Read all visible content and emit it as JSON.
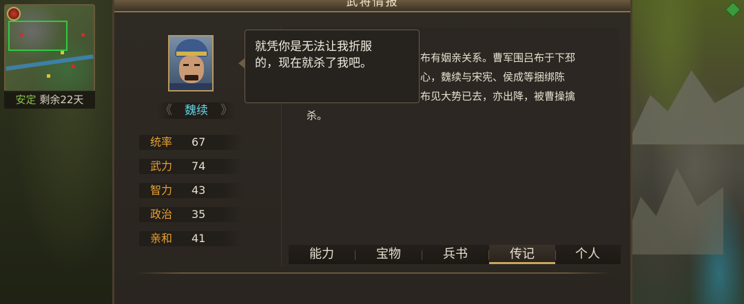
{
  "window": {
    "title": "武将情报"
  },
  "minimap": {
    "status_word": "安定",
    "remaining_label": "剩余22天"
  },
  "general": {
    "name": "魏续",
    "stats": [
      {
        "label": "统率",
        "value": "67"
      },
      {
        "label": "武力",
        "value": "74"
      },
      {
        "label": "智力",
        "value": "43"
      },
      {
        "label": "政治",
        "value": "35"
      },
      {
        "label": "亲和",
        "value": "41"
      }
    ]
  },
  "speech": {
    "text": "就凭你是无法让我折服\n的，现在就杀了我吧。"
  },
  "biography": {
    "lines": [
      "吕布有姻亲关系。曹军围吕布于下邳",
      "离心，魏续与宋宪、侯成等捆绑陈",
      "吕布见大势已去，亦出降，被曹操擒",
      "杀。"
    ]
  },
  "tabs": [
    {
      "label": "能力",
      "active": false
    },
    {
      "label": "宝物",
      "active": false
    },
    {
      "label": "兵书",
      "active": false
    },
    {
      "label": "传记",
      "active": true
    },
    {
      "label": "个人",
      "active": false
    }
  ],
  "colors": {
    "accent_gold": "#c9a65a",
    "stat_label": "#e8a030",
    "name_cyan": "#5fd3e6",
    "status_green": "#8bc34a"
  }
}
